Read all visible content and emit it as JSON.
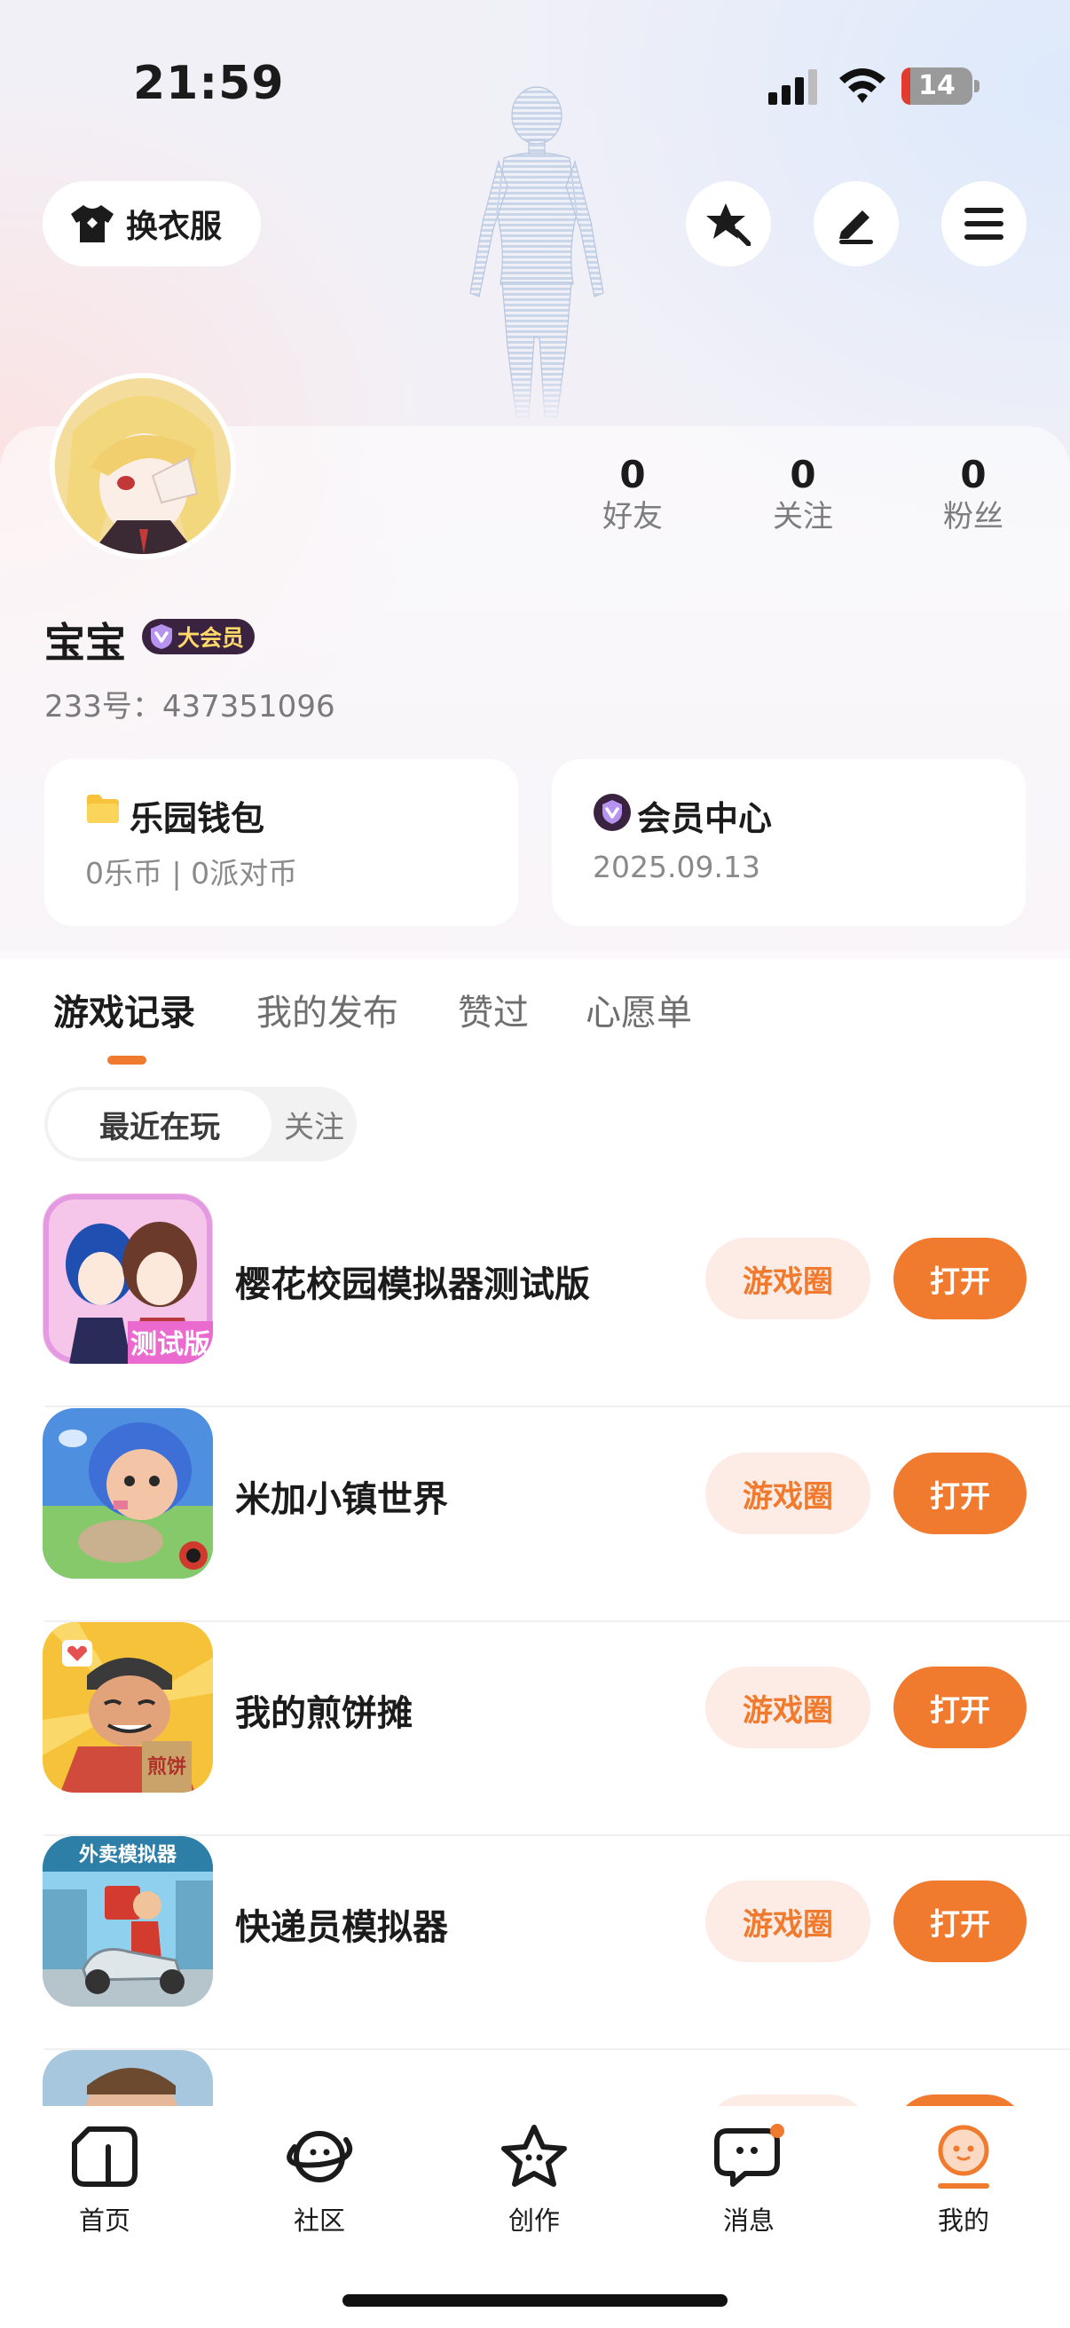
{
  "status_bar": {
    "time": "21:59",
    "battery": "14"
  },
  "header": {
    "outfit_label": "换衣服"
  },
  "profile": {
    "stats": [
      {
        "value": "0",
        "label": "好友"
      },
      {
        "value": "0",
        "label": "关注"
      },
      {
        "value": "0",
        "label": "粉丝"
      }
    ],
    "nickname": "宝宝",
    "vip_badge": "大会员",
    "user_id": "233号：437351096"
  },
  "cards": {
    "wallet": {
      "title": "乐园钱包",
      "sub": "0乐币 | 0派对币"
    },
    "vip": {
      "title": "会员中心",
      "sub": "2025.09.13"
    }
  },
  "tabs": [
    {
      "label": "游戏记录",
      "active": true
    },
    {
      "label": "我的发布",
      "active": false
    },
    {
      "label": "赞过",
      "active": false
    },
    {
      "label": "心愿单",
      "active": false
    }
  ],
  "segment": {
    "recent": "最近在玩",
    "follow": "关注"
  },
  "games": [
    {
      "name": "樱花校园模拟器测试版",
      "icon_text": "测试版",
      "circle_label": "游戏圈",
      "open_label": "打开"
    },
    {
      "name": "米加小镇世界",
      "circle_label": "游戏圈",
      "open_label": "打开"
    },
    {
      "name": "我的煎饼摊",
      "icon_text": "煎饼",
      "circle_label": "游戏圈",
      "open_label": "打开"
    },
    {
      "name": "快递员模拟器",
      "icon_text": "外卖模拟器",
      "circle_label": "游戏圈",
      "open_label": "打开"
    }
  ],
  "nav": [
    {
      "label": "首页",
      "icon": "home-icon"
    },
    {
      "label": "社区",
      "icon": "planet-icon"
    },
    {
      "label": "创作",
      "icon": "star-icon"
    },
    {
      "label": "消息",
      "icon": "chat-icon"
    },
    {
      "label": "我的",
      "icon": "profile-icon"
    }
  ],
  "colors": {
    "accent": "#f07a2e",
    "accent_light": "#fdebe5",
    "vip_bg": "#3a2340"
  }
}
